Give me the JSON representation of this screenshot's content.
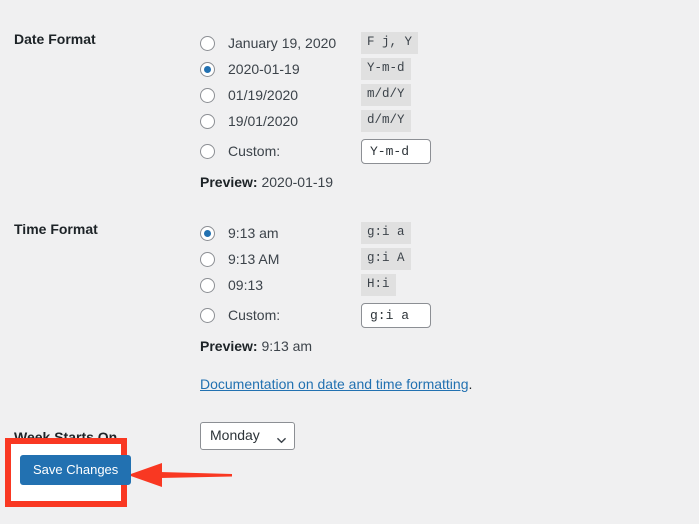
{
  "page": {
    "background_color": "#f0f0f1",
    "accent_color": "#2271b1",
    "annotation_color": "#f93822"
  },
  "date_format": {
    "label": "Date Format",
    "options": [
      {
        "label": "January 19, 2020",
        "code": "F j, Y",
        "selected": false
      },
      {
        "label": "2020-01-19",
        "code": "Y-m-d",
        "selected": true
      },
      {
        "label": "01/19/2020",
        "code": "m/d/Y",
        "selected": false
      },
      {
        "label": "19/01/2020",
        "code": "d/m/Y",
        "selected": false
      }
    ],
    "custom_label": "Custom:",
    "custom_value": "Y-m-d",
    "custom_selected": false,
    "preview_key": "Preview:",
    "preview_value": "2020-01-19"
  },
  "time_format": {
    "label": "Time Format",
    "options": [
      {
        "label": "9:13 am",
        "code": "g:i a",
        "selected": true
      },
      {
        "label": "9:13 AM",
        "code": "g:i A",
        "selected": false
      },
      {
        "label": "09:13",
        "code": "H:i",
        "selected": false
      }
    ],
    "custom_label": "Custom:",
    "custom_value": "g:i a",
    "custom_selected": false,
    "preview_key": "Preview:",
    "preview_value": "9:13 am",
    "documentation_link": "Documentation on date and time formatting",
    "documentation_suffix": "."
  },
  "week_starts_on": {
    "label": "Week Starts On",
    "selected": "Monday",
    "icon": "chevron-down-icon"
  },
  "submit": {
    "save_label": "Save Changes"
  },
  "annotation": {
    "highlight_target": "save-changes-button",
    "arrow_direction": "left"
  }
}
